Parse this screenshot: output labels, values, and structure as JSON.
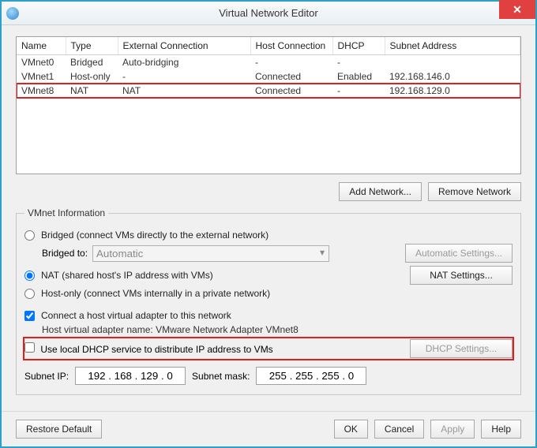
{
  "window": {
    "title": "Virtual Network Editor"
  },
  "table": {
    "headers": {
      "name": "Name",
      "type": "Type",
      "external": "External Connection",
      "host": "Host Connection",
      "dhcp": "DHCP",
      "subnet": "Subnet Address"
    },
    "rows": [
      {
        "name": "VMnet0",
        "type": "Bridged",
        "external": "Auto-bridging",
        "host": "-",
        "dhcp": "-",
        "subnet": ""
      },
      {
        "name": "VMnet1",
        "type": "Host-only",
        "external": "-",
        "host": "Connected",
        "dhcp": "Enabled",
        "subnet": "192.168.146.0"
      },
      {
        "name": "VMnet8",
        "type": "NAT",
        "external": "NAT",
        "host": "Connected",
        "dhcp": "-",
        "subnet": "192.168.129.0"
      }
    ]
  },
  "buttons": {
    "add_network": "Add Network...",
    "remove_network": "Remove Network",
    "auto_settings": "Automatic Settings...",
    "nat_settings": "NAT Settings...",
    "dhcp_settings": "DHCP Settings...",
    "restore_default": "Restore Default",
    "ok": "OK",
    "cancel": "Cancel",
    "apply": "Apply",
    "help": "Help"
  },
  "info": {
    "legend": "VMnet Information",
    "bridged_label": "Bridged (connect VMs directly to the external network)",
    "bridged_to_label": "Bridged to:",
    "bridged_to_value": "Automatic",
    "nat_label": "NAT (shared host's IP address with VMs)",
    "hostonly_label": "Host-only (connect VMs internally in a private network)",
    "connect_adapter_label": "Connect a host virtual adapter to this network",
    "adapter_name_label": "Host virtual adapter name: VMware Network Adapter VMnet8",
    "dhcp_label": "Use local DHCP service to distribute IP address to VMs",
    "subnet_ip_label": "Subnet IP:",
    "subnet_ip_value": "192 . 168 . 129 . 0",
    "subnet_mask_label": "Subnet mask:",
    "subnet_mask_value": "255 . 255 . 255 . 0"
  }
}
